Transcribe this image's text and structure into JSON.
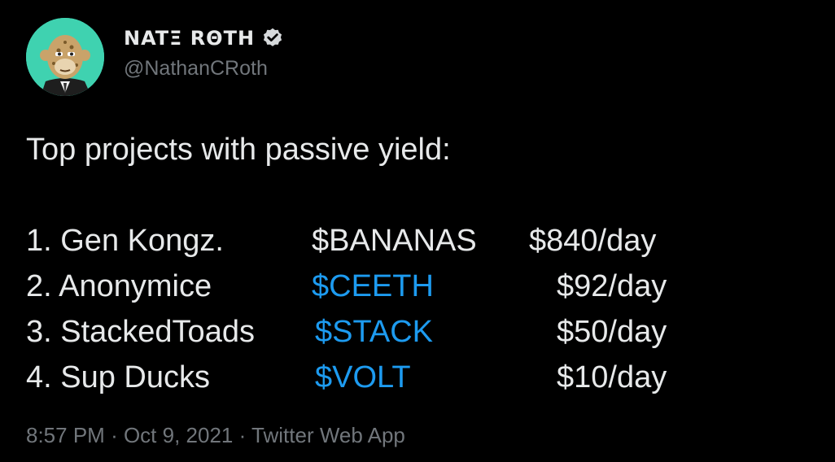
{
  "author": {
    "display_name": "NATΞ RΘTH",
    "handle": "@NathanCRoth",
    "verified_icon": "verified-badge-icon",
    "avatar_bg": "#3fd2b0"
  },
  "tweet": {
    "headline": "Top projects with passive yield:",
    "rows": [
      {
        "project": "1. Gen Kongz.",
        "token": "$BANANAS",
        "token_linked": false,
        "yield": "$840/day"
      },
      {
        "project": "2. Anonymice",
        "token": "$CEETH",
        "token_linked": true,
        "yield": "$92/day"
      },
      {
        "project": "3. StackedToads",
        "token": "$STACK",
        "token_linked": true,
        "yield": "$50/day"
      },
      {
        "project": "4. Sup Ducks",
        "token": "$VOLT",
        "token_linked": true,
        "yield": "$10/day"
      }
    ]
  },
  "meta": {
    "time": "8:57 PM",
    "date": "Oct 9, 2021",
    "source": "Twitter Web App"
  },
  "colors": {
    "background": "#000000",
    "text": "#e7e9ea",
    "secondary": "#71767b",
    "link": "#1d9bf0"
  }
}
